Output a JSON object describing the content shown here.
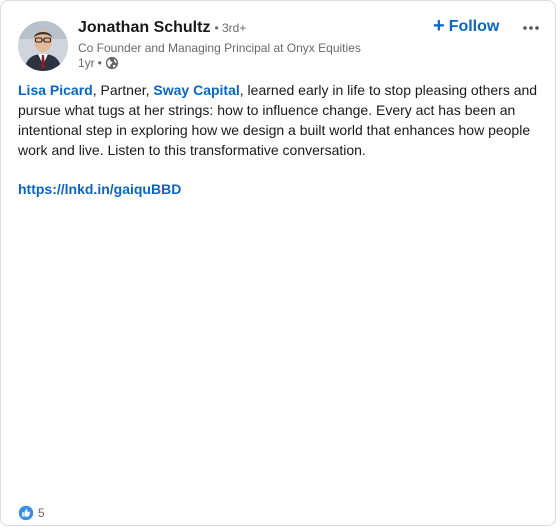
{
  "post": {
    "author": {
      "name": "Jonathan Schultz",
      "degree_separator": " • ",
      "degree": "3rd+",
      "headline": "Co Founder and Managing Principal at Onyx Equities",
      "time": "1yr",
      "time_separator": "•",
      "visibility_icon": "globe-icon"
    },
    "actions": {
      "follow_icon": "+",
      "follow_label": "Follow",
      "more_icon": "ellipsis-icon"
    },
    "body": {
      "mention_1": "Lisa Picard",
      "text_1": ", Partner, ",
      "mention_2": "Sway Capital",
      "text_2": ", learned early in life to stop pleasing others and pursue what tugs at her strings: how to influence change. Every act has been an intentional step in exploring how we design a built world that enhances how people work and live. Listen to this transformative conversation.",
      "link": "https://lnkd.in/gaiquBBD"
    },
    "reactions": {
      "icon": "like-icon",
      "count": "5"
    }
  },
  "colors": {
    "link_blue": "#0a66c2",
    "secondary_text": "#666666",
    "border": "#dcdcdc"
  }
}
